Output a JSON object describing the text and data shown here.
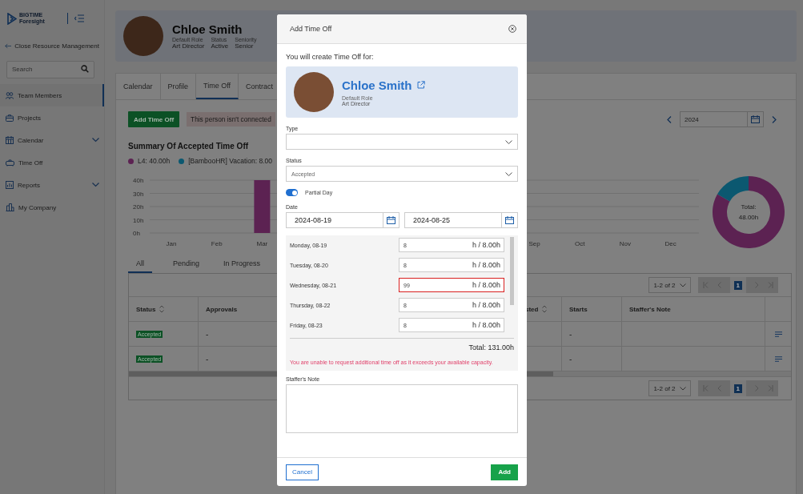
{
  "sidebar": {
    "logo": {
      "line_1": "BIGTIME",
      "line_2": "Foresight"
    },
    "back_link": "Close Resource Management",
    "search": {
      "placeholder": "Search"
    },
    "items": [
      {
        "label": "Team Members",
        "selected": true,
        "has_submenu": false
      },
      {
        "label": "Projects",
        "selected": false,
        "has_submenu": false
      },
      {
        "label": "Calendar",
        "selected": false,
        "has_submenu": true
      },
      {
        "label": "Time Off",
        "selected": false,
        "has_submenu": false
      },
      {
        "label": "Reports",
        "selected": false,
        "has_submenu": true
      },
      {
        "label": "My Company",
        "selected": false,
        "has_submenu": false
      }
    ]
  },
  "profile": {
    "name": "Chloe Smith",
    "fields": [
      {
        "label": "Default Role",
        "value": "Art Director"
      },
      {
        "label": "Status",
        "value": "Active"
      },
      {
        "label": "Seniority",
        "value": "Senior"
      }
    ]
  },
  "tabs": [
    {
      "label": "Calendar",
      "selected": false
    },
    {
      "label": "Profile",
      "selected": false
    },
    {
      "label": "Time Off",
      "selected": true
    },
    {
      "label": "Contract",
      "selected": false
    }
  ],
  "toolbar": {
    "add_button": "Add Time Off",
    "notice": "This person isn't connected",
    "year": "2024"
  },
  "summary": {
    "title": "Summary Of Accepted Time Off",
    "legend": [
      {
        "label": "L4: 40.00h",
        "color": "#5c2252"
      },
      {
        "label": "[BambooHR] Vacation: 8.00",
        "color": "#0b5870"
      }
    ],
    "chart_data": {
      "type": "bar",
      "grid": true,
      "categories": [
        "Jan",
        "Feb",
        "Mar",
        null,
        null,
        null,
        null,
        null,
        "Sep",
        "Oct",
        "Nov",
        "Dec"
      ],
      "values": [
        0,
        0,
        40,
        null,
        null,
        null,
        null,
        null,
        0,
        0,
        0,
        0
      ],
      "ylim": [
        0,
        40
      ],
      "yticks": [
        {
          "value": 0,
          "label": "0h"
        },
        {
          "value": 10,
          "label": "10h"
        },
        {
          "value": 20,
          "label": "20h"
        },
        {
          "value": 30,
          "label": "30h"
        },
        {
          "value": 40,
          "label": "40h"
        }
      ]
    },
    "donut": {
      "total_label": "Total:",
      "total_value": "48.00h",
      "chart_data": {
        "type": "donut",
        "values": [
          83.33,
          16.67
        ]
      }
    }
  },
  "status_tabs": [
    {
      "label": "All",
      "selected": true
    },
    {
      "label": "Pending",
      "selected": false
    },
    {
      "label": "In Progress",
      "selected": false
    }
  ],
  "table": {
    "pagination": {
      "range": "1-2 of 2",
      "page": "1"
    },
    "columns": [
      {
        "label": "Status",
        "sortable": true
      },
      {
        "label": "Approvals",
        "sortable": false
      },
      {
        "label": "sted",
        "sortable": true
      },
      {
        "label": "Starts",
        "sortable": false
      },
      {
        "label": "Staffer's Note",
        "sortable": false
      }
    ],
    "rows": [
      {
        "status": "Accepted",
        "approvals": "-",
        "starts": "-"
      },
      {
        "status": "Accepted",
        "approvals": "-",
        "starts": "-"
      }
    ],
    "footer_pagination": {
      "range": "1-2 of 2",
      "page": "1"
    }
  },
  "modal": {
    "title": "Add Time Off",
    "intro": "You will create Time Off for:",
    "person": {
      "name": "Chloe Smith",
      "role_label": "Default Role",
      "role": "Art Director"
    },
    "type": {
      "label": "Type"
    },
    "status": {
      "label": "Status",
      "value": "Accepted"
    },
    "partial_day": {
      "label": "Partial Day",
      "on": true
    },
    "date": {
      "label": "Date",
      "start": "2024-08-19",
      "end": "2024-08-25"
    },
    "days": [
      {
        "label": "Monday, 08-19",
        "value": "8",
        "capacity": "h / 8.00h",
        "error": false
      },
      {
        "label": "Tuesday, 08-20",
        "value": "8",
        "capacity": "h / 8.00h",
        "error": false
      },
      {
        "label": "Wednesday, 08-21",
        "value": "99",
        "capacity": "h / 8.00h",
        "error": true
      },
      {
        "label": "Thursday, 08-22",
        "value": "8",
        "capacity": "h / 8.00h",
        "error": false
      },
      {
        "label": "Friday, 08-23",
        "value": "8",
        "capacity": "h / 8.00h",
        "error": false
      }
    ],
    "total": "Total: 131.00h",
    "error_message": "You are unable to request additional time off as it exceeds your available capacity.",
    "note": {
      "label": "Staffer's Note"
    },
    "buttons": {
      "cancel": "Cancel",
      "add": "Add"
    }
  }
}
